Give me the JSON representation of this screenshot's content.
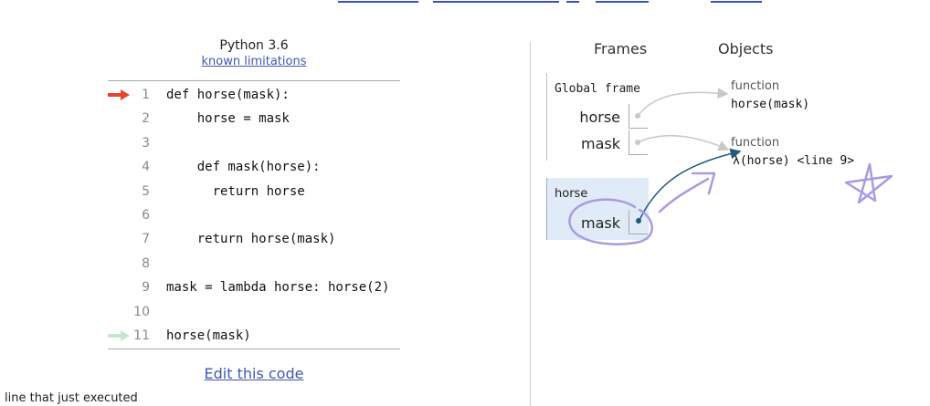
{
  "header": {
    "language": "Python 3.6",
    "limitations_link": "known limitations"
  },
  "code": {
    "lines": [
      {
        "num": "1",
        "text": "def horse(mask):"
      },
      {
        "num": "2",
        "text": "    horse = mask"
      },
      {
        "num": "3",
        "text": ""
      },
      {
        "num": "4",
        "text": "    def mask(horse):"
      },
      {
        "num": "5",
        "text": "      return horse"
      },
      {
        "num": "6",
        "text": ""
      },
      {
        "num": "7",
        "text": "    return horse(mask)"
      },
      {
        "num": "8",
        "text": ""
      },
      {
        "num": "9",
        "text": "mask = lambda horse: horse(2)"
      },
      {
        "num": "10",
        "text": ""
      },
      {
        "num": "11",
        "text": "horse(mask)"
      }
    ],
    "current_line_color": "#e8432e",
    "prev_line_color": "#c3e8cf"
  },
  "footer": {
    "edit_link": "Edit this code",
    "legend_text": "line that just executed"
  },
  "viz": {
    "frames_heading": "Frames",
    "objects_heading": "Objects",
    "global_frame": {
      "title": "Global frame",
      "vars": [
        "horse",
        "mask"
      ]
    },
    "horse_frame": {
      "title": "horse",
      "vars": [
        "mask"
      ],
      "bg_color": "#e1ebf7"
    },
    "objects": [
      {
        "type": "function",
        "value": "horse(mask)"
      },
      {
        "type": "function",
        "value": "λ(horse) <line 9>"
      }
    ],
    "annotation_color": "#a79be3",
    "pointer_color": "#1f5a7a"
  }
}
